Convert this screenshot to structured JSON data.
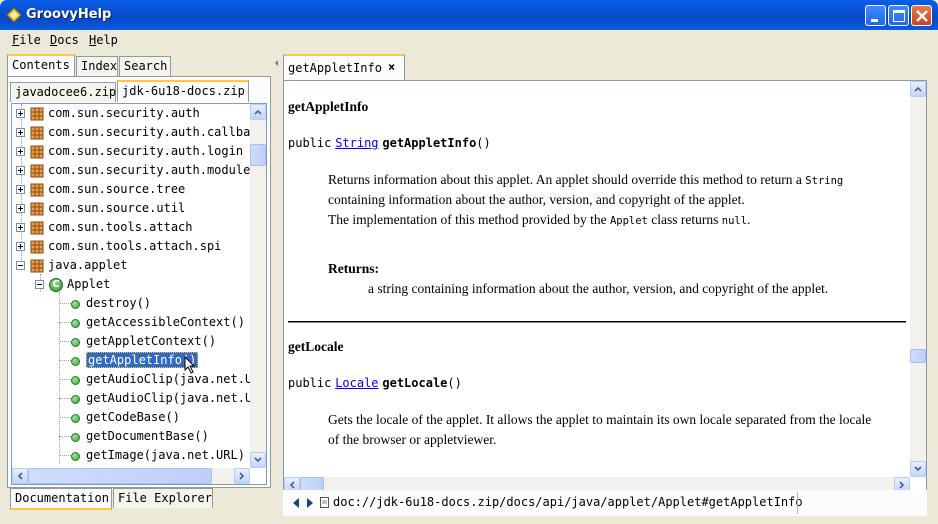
{
  "window": {
    "title": "GroovyHelp"
  },
  "menu": [
    "File",
    "Docs",
    "Help"
  ],
  "left_panel": {
    "top_tabs": [
      "Contents",
      "Index",
      "Search"
    ],
    "active_top_tab": "Contents",
    "source_tabs": [
      "javadocee6.zip",
      "jdk-6u18-docs.zip"
    ],
    "active_source_tab": "jdk-6u18-docs.zip",
    "tree": [
      {
        "label": "com.sun.security.auth",
        "kind": "package",
        "expanded": false
      },
      {
        "label": "com.sun.security.auth.callba",
        "kind": "package",
        "expanded": false
      },
      {
        "label": "com.sun.security.auth.login",
        "kind": "package",
        "expanded": false
      },
      {
        "label": "com.sun.security.auth.module",
        "kind": "package",
        "expanded": false
      },
      {
        "label": "com.sun.source.tree",
        "kind": "package",
        "expanded": false
      },
      {
        "label": "com.sun.source.util",
        "kind": "package",
        "expanded": false
      },
      {
        "label": "com.sun.tools.attach",
        "kind": "package",
        "expanded": false
      },
      {
        "label": "com.sun.tools.attach.spi",
        "kind": "package",
        "expanded": false
      },
      {
        "label": "java.applet",
        "kind": "package",
        "expanded": true
      },
      {
        "label": "Applet",
        "kind": "class",
        "expanded": true
      },
      {
        "label": "destroy()",
        "kind": "method"
      },
      {
        "label": "getAccessibleContext()",
        "kind": "method"
      },
      {
        "label": "getAppletContext()",
        "kind": "method"
      },
      {
        "label": "getAppletInfo()",
        "kind": "method",
        "selected": true
      },
      {
        "label": "getAudioClip(java.net.U",
        "kind": "method"
      },
      {
        "label": "getAudioClip(java.net.U",
        "kind": "method"
      },
      {
        "label": "getCodeBase()",
        "kind": "method"
      },
      {
        "label": "getDocumentBase()",
        "kind": "method"
      },
      {
        "label": "getImage(java.net.URL)",
        "kind": "method"
      }
    ],
    "bottom_tabs": [
      "Documentation",
      "File Explorer"
    ],
    "active_bottom_tab": "Documentation"
  },
  "doc_tab": {
    "label": "getAppletInfo",
    "close": "×"
  },
  "doc": {
    "section1": {
      "heading": "getAppletInfo",
      "sig_public": "public",
      "sig_type": "String",
      "sig_name": "getAppletInfo",
      "sig_parens": "()",
      "desc_l1_pre": "Returns information about this applet. An applet should override this method to return a",
      "desc_l1_code": "String",
      "desc_l2": "containing information about the author, version, and copyright of the applet.",
      "desc_l3_pre": "The implementation of this method provided by the",
      "desc_l3_code1": "Applet",
      "desc_l3_mid": "class returns",
      "desc_l3_code2": "null",
      "desc_l3_end": ".",
      "returns_label": "Returns:",
      "returns_text": "a string containing information about the author, version, and copyright of the applet."
    },
    "section2": {
      "heading": "getLocale",
      "sig_public": "public",
      "sig_type": "Locale",
      "sig_name": "getLocale",
      "sig_parens": "()",
      "desc_l1": "Gets the locale of the applet. It allows the applet to maintain its own locale separated from the locale",
      "desc_l2": "of the browser or appletviewer."
    }
  },
  "status": {
    "url": "doc://jdk-6u18-docs.zip/docs/api/java/applet/Applet#getAppletInfo"
  },
  "colors": {
    "title_bar": "#0A5EE8",
    "selection": "#316AC5",
    "tab_highlight": "#FFC83C",
    "link": "#0000EE"
  }
}
